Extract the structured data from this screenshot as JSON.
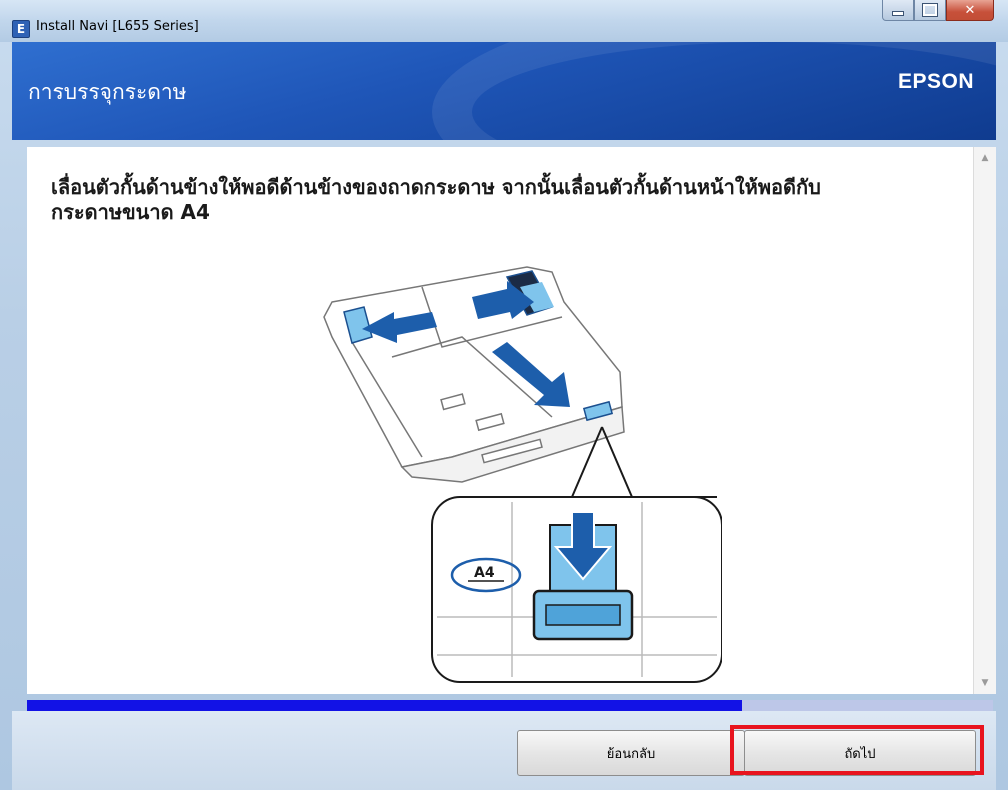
{
  "window": {
    "title": "Install Navi [L655 Series]",
    "app_icon_glyph": "E",
    "controls": {
      "minimize": "minimize-icon",
      "maximize": "maximize-icon",
      "close": "close-icon",
      "close_glyph": "✕"
    }
  },
  "header": {
    "title": "การบรรจุกระดาษ",
    "brand": "EPSON"
  },
  "content": {
    "instruction_line1": "เลื่อนตัวกั้นด้านข้างให้พอดีด้านข้างของถาดกระดาษ จากนั้นเลื่อนตัวกั้นด้านหน้าให้พอดีกับ",
    "instruction_line2": "กระดาษขนาด A4",
    "illustration": {
      "paper_size_label": "A4",
      "arrow_color": "#1d5eab",
      "guide_color": "#7fc4ec"
    }
  },
  "progress": {
    "value_percent": 74,
    "fill_color": "#1212e6",
    "track_color": "#bdc7e8"
  },
  "buttons": {
    "back_label": "ย้อนกลับ",
    "next_label": "ถัดไป",
    "highlight_color": "#e8141e"
  },
  "scrollbar": {
    "up_icon": "▲",
    "down_icon": "▼"
  }
}
